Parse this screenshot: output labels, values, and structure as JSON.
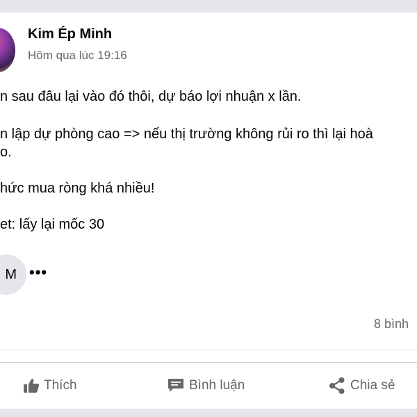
{
  "post": {
    "author": "Kim Ép Minh",
    "timestamp": "Hôm qua lúc 19:16",
    "lines": [
      "n sau đâu lại vào đó thôi, dự báo lợi nhuận x lần.",
      "n lập dự phòng cao => nếu thị trường không rủi ro thì lại hoà",
      "o.",
      "hức mua ròng khá nhiều!",
      "et: lấy lại mốc 30"
    ]
  },
  "reactions": {
    "avatar_initial": "M",
    "more_label": "•••"
  },
  "stats": {
    "comments": "8 bình"
  },
  "actions": {
    "like": "Thích",
    "comment": "Bình luận",
    "share": "Chia sẻ"
  },
  "icons": {
    "like": "thumbs-up-icon",
    "comment": "comment-icon",
    "share": "share-icon"
  },
  "colors": {
    "text": "#050505",
    "muted": "#65676b",
    "band": "#e4e6eb"
  }
}
